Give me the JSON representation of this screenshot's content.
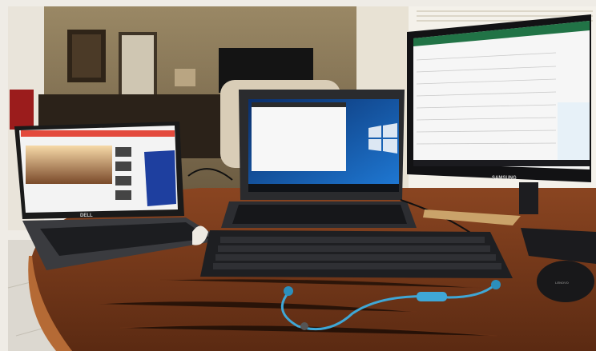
{
  "scene": {
    "description_id": "desk-with-three-computers",
    "laptop_left_brand": "DELL",
    "monitor_brand": "SAMSUNG",
    "mouse_brand": "LENOVO"
  },
  "colors": {
    "wall": "#8c7a5c",
    "wall_dark": "#5e4f38",
    "table_wood": "#7a3b1c",
    "table_wood_light": "#a5552a",
    "floor": "#d9d6cf",
    "window_light": "#f4f1ea",
    "excel_green": "#217346",
    "win_blue": "#0a4ea3",
    "earbud_cable": "#3fa7d6",
    "keyboard": "#1e1f22"
  }
}
